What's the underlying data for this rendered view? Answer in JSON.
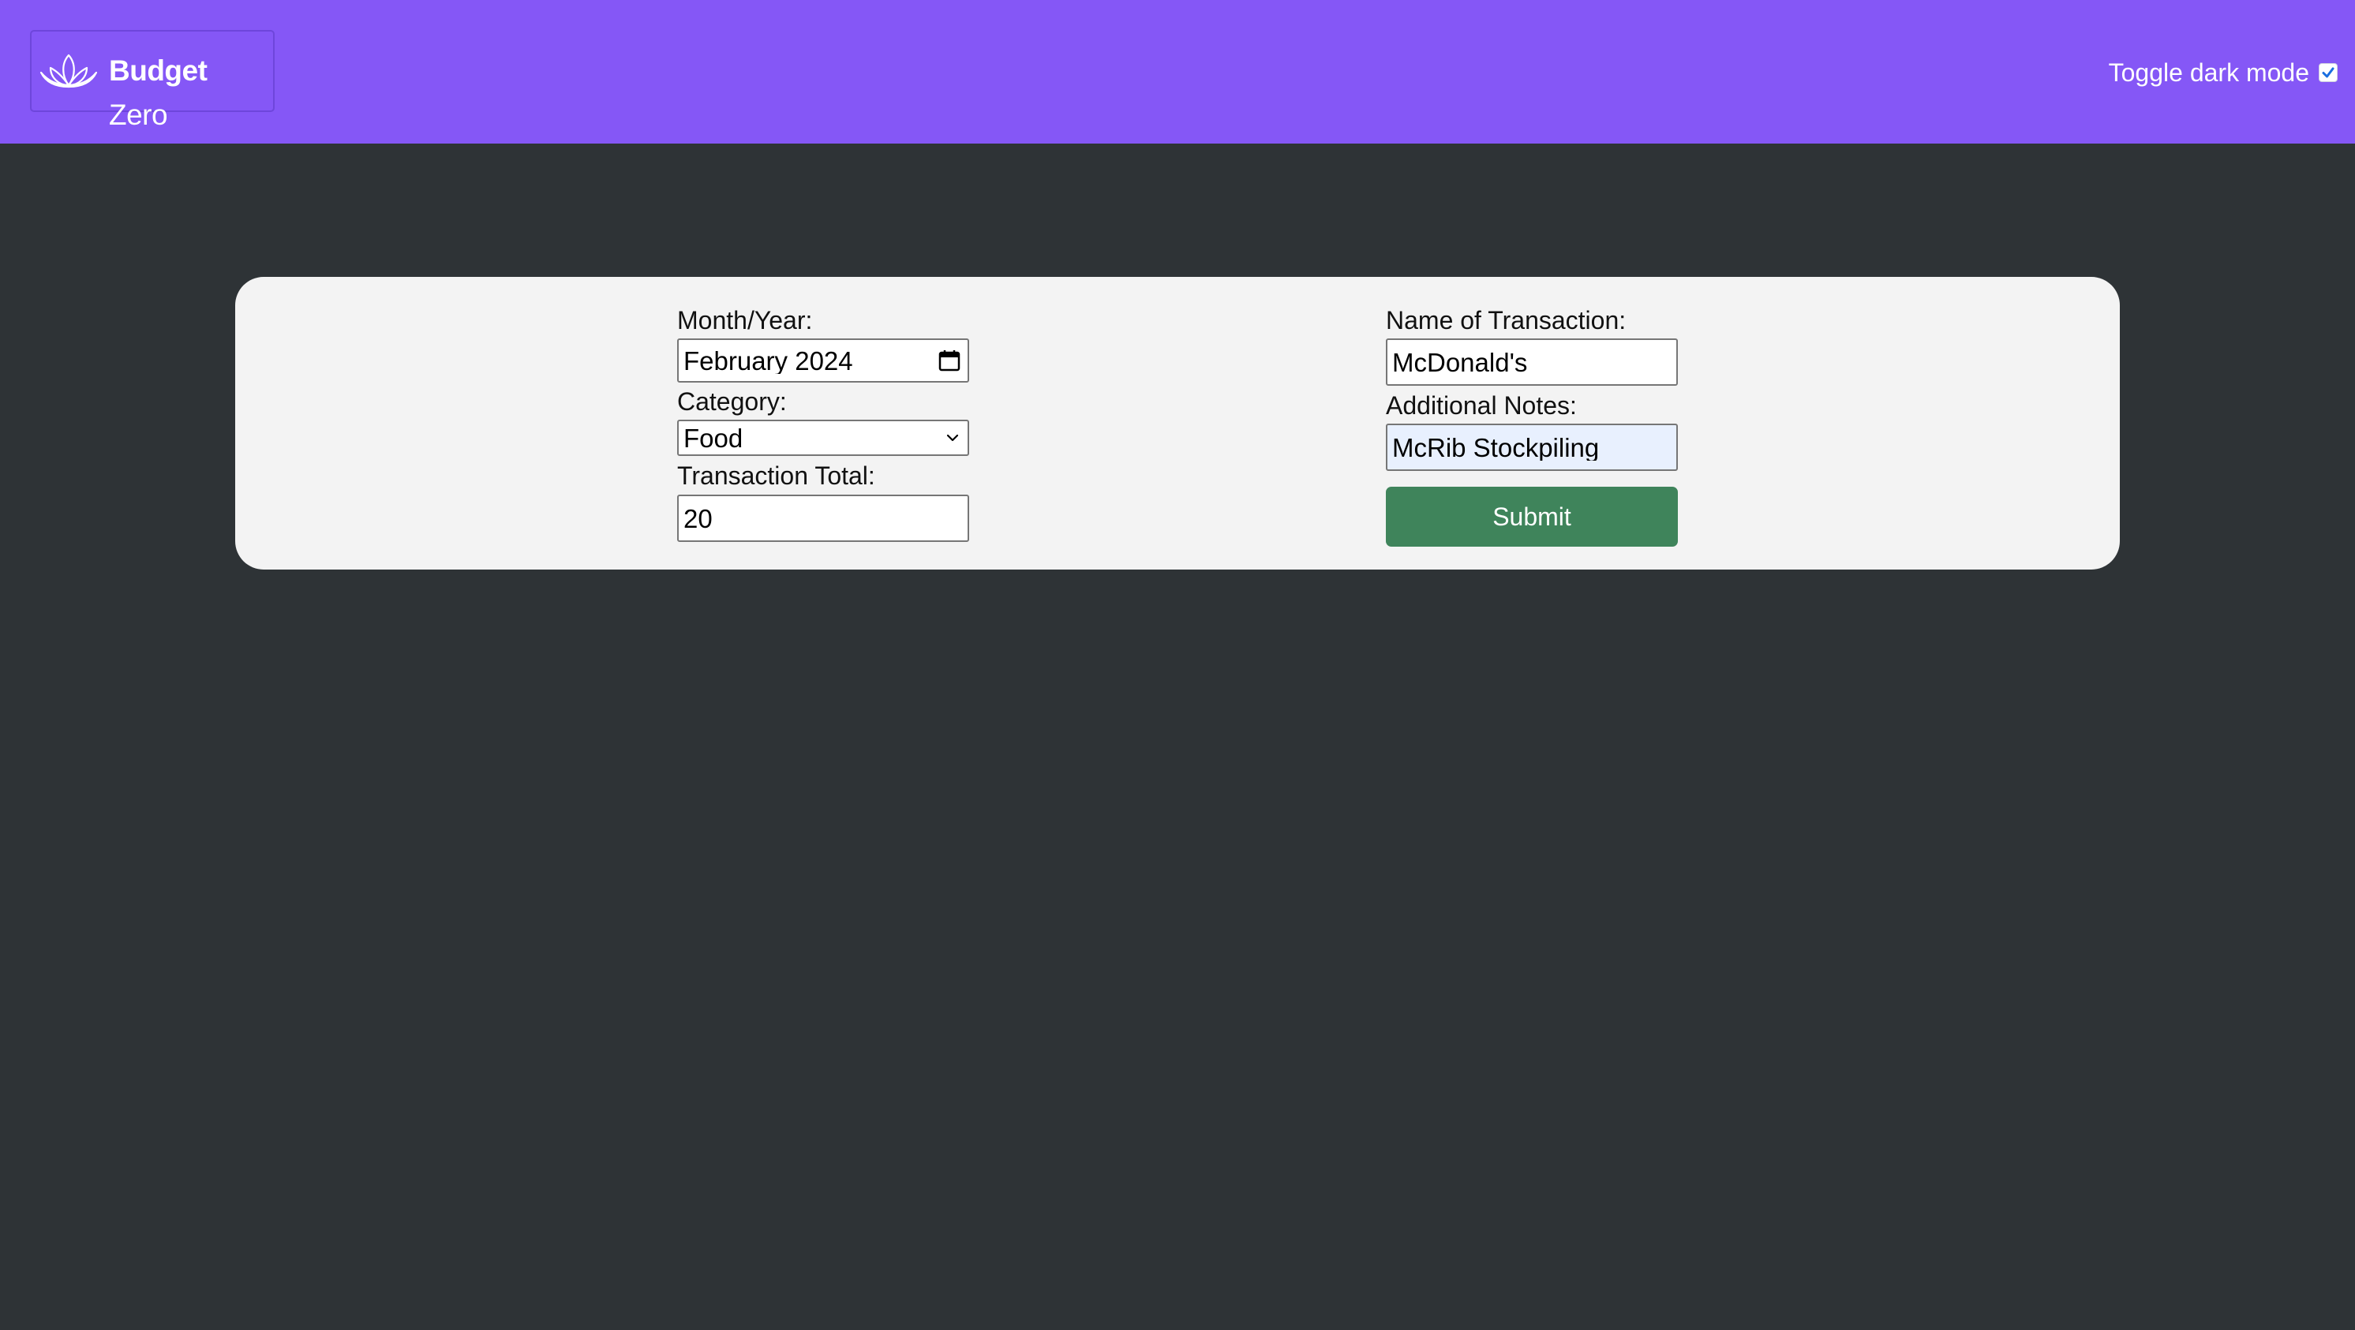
{
  "brand": {
    "name_bold": "Budget",
    "name_light": "Zero",
    "icon": "lotus-icon"
  },
  "header": {
    "toggle_label": "Toggle dark mode",
    "dark_mode_checked": true,
    "background_color": "#8557f6"
  },
  "form": {
    "month_year": {
      "label": "Month/Year:",
      "value": "February 2024",
      "icon": "calendar-icon"
    },
    "category": {
      "label": "Category:",
      "selected": "Food",
      "icon": "chevron-down-icon"
    },
    "transaction_total": {
      "label": "Transaction Total:",
      "value": "20"
    },
    "transaction_name": {
      "label": "Name of Transaction:",
      "value": "McDonald's"
    },
    "additional_notes": {
      "label": "Additional Notes:",
      "value": "McRib Stockpiling"
    },
    "submit_label": "Submit"
  },
  "colors": {
    "page_background": "#2e3336",
    "card_background": "#f3f3f3",
    "submit_button": "#3f845b"
  }
}
